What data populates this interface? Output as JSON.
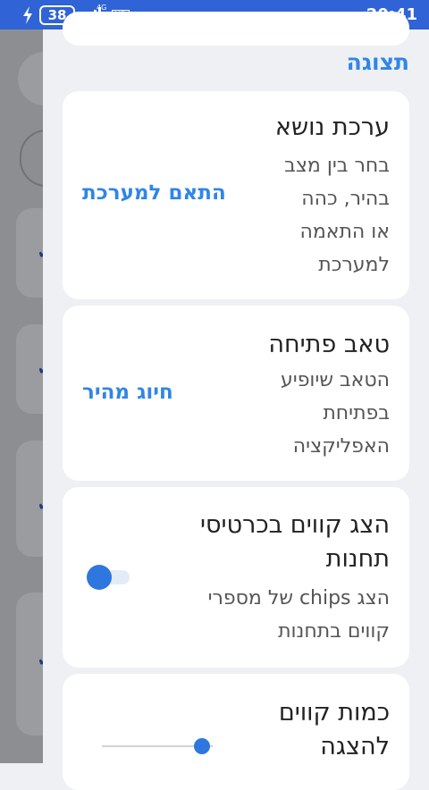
{
  "status_bar": {
    "battery_level": "38",
    "network_type": "4G",
    "hd_label": "HD",
    "time": "20:41"
  },
  "display_section": {
    "title": "תצוגה",
    "theme": {
      "title": "ערכת נושא",
      "description_lines": [
        "בחר בין מצב",
        "בהיר, כהה",
        "או התאמה",
        "למערכת"
      ],
      "value": "התאם למערכת"
    },
    "start_tab": {
      "title": "טאב פתיחה",
      "description_lines": [
        "הטאב שיופיע",
        "בפתיחת",
        "האפליקציה"
      ],
      "value": "חיוג מהיר"
    },
    "show_lines_chips": {
      "title_lines": [
        "הצג קווים בכרטיסי",
        "תחנות"
      ],
      "description_lines": [
        "הצג chips של מספרי",
        "קווים בתחנות"
      ],
      "enabled": true
    },
    "lines_count": {
      "title_lines": [
        "כמות קווים",
        "להצגה"
      ],
      "slider_fraction": 0.9
    }
  },
  "colors": {
    "status_bar": "#2f63d6",
    "accent": "#2f86e6",
    "toggle_knob": "#2d77de"
  }
}
